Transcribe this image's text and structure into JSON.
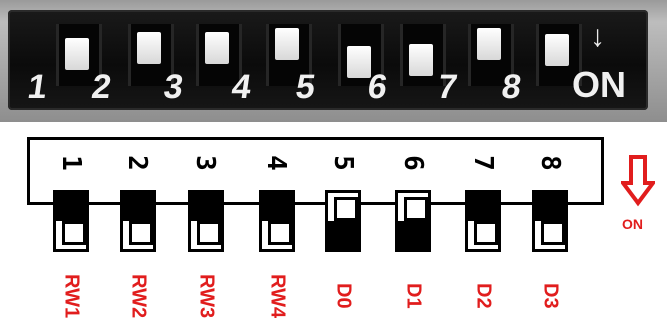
{
  "photo": {
    "switch_numbers": [
      "1",
      "2",
      "3",
      "4",
      "5",
      "6",
      "7",
      "8"
    ],
    "on_label": "ON",
    "arrow_symbol": "↓"
  },
  "schematic": {
    "switch_numbers": [
      "1",
      "2",
      "3",
      "4",
      "5",
      "6",
      "7",
      "8"
    ],
    "labels": [
      "RW1",
      "RW2",
      "RW3",
      "RW4",
      "D0",
      "D1",
      "D2",
      "D3"
    ],
    "on_label": "ON",
    "switch_states": [
      "on",
      "on",
      "on",
      "on",
      "off",
      "off",
      "on",
      "on"
    ],
    "label_color": "#e11d1d"
  }
}
